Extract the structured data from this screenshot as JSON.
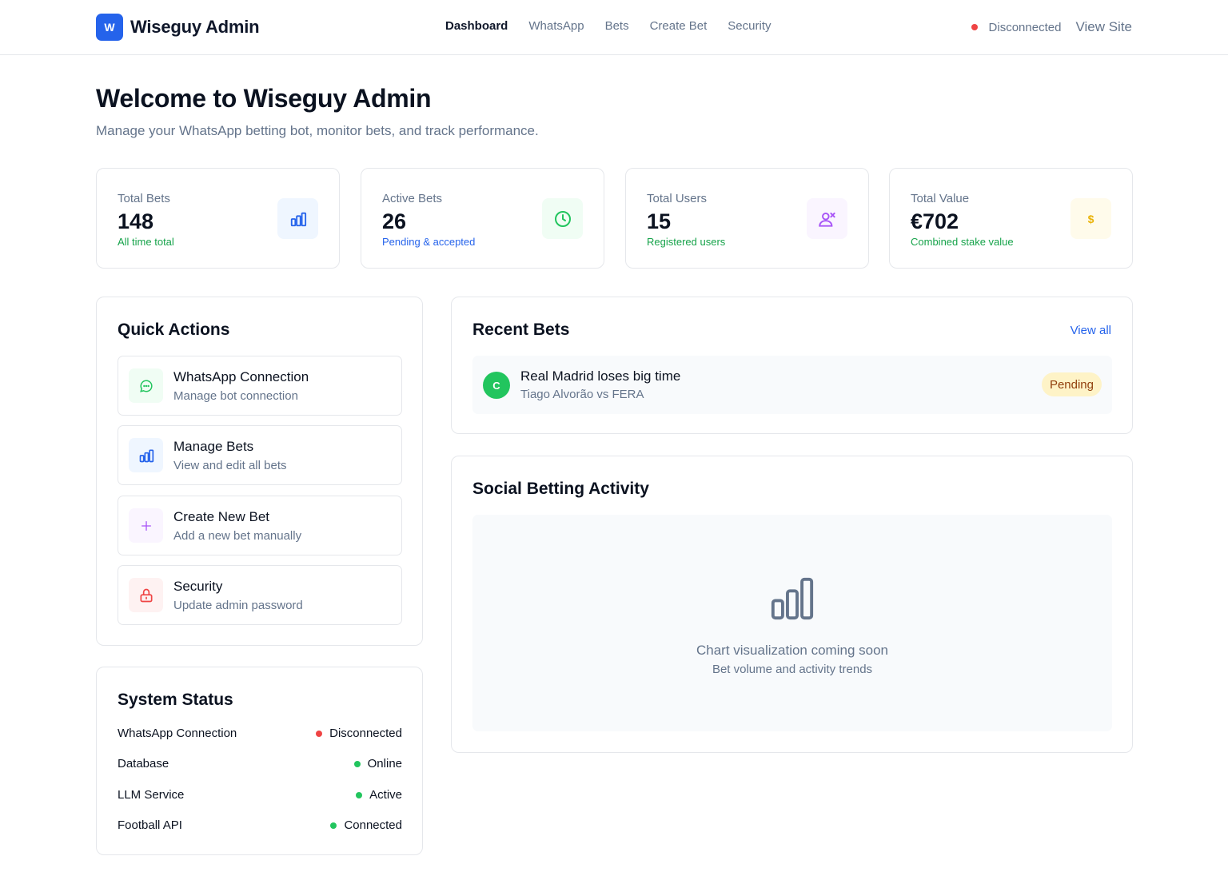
{
  "brand": {
    "mark": "W",
    "name": "Wiseguy Admin"
  },
  "nav": {
    "items": [
      "Dashboard",
      "WhatsApp",
      "Bets",
      "Create Bet",
      "Security"
    ],
    "active": "Dashboard"
  },
  "header": {
    "connection_status": "Disconnected",
    "view_site": "View Site"
  },
  "intro": {
    "title": "Welcome to Wiseguy Admin",
    "subtitle": "Manage your WhatsApp betting bot, monitor bets, and track performance."
  },
  "stats": [
    {
      "label": "Total Bets",
      "value": "148",
      "note": "All time total",
      "icon": "bar-chart-icon",
      "note_color": "#16a34a"
    },
    {
      "label": "Active Bets",
      "value": "26",
      "note": "Pending & accepted",
      "icon": "clock-icon",
      "note_color": "#2563eb"
    },
    {
      "label": "Total Users",
      "value": "15",
      "note": "Registered users",
      "icon": "users-icon",
      "note_color": "#16a34a"
    },
    {
      "label": "Total Value",
      "value": "€702",
      "note": "Combined stake value",
      "icon": "dollar-icon",
      "note_color": "#16a34a"
    }
  ],
  "quick_actions": {
    "title": "Quick Actions",
    "items": [
      {
        "title": "WhatsApp Connection",
        "subtitle": "Manage bot connection",
        "icon": "chat-icon"
      },
      {
        "title": "Manage Bets",
        "subtitle": "View and edit all bets",
        "icon": "bar-chart-icon"
      },
      {
        "title": "Create New Bet",
        "subtitle": "Add a new bet manually",
        "icon": "plus-icon"
      },
      {
        "title": "Security",
        "subtitle": "Update admin password",
        "icon": "lock-icon"
      }
    ]
  },
  "system_status": {
    "title": "System Status",
    "rows": [
      {
        "label": "WhatsApp Connection",
        "status": "Disconnected",
        "color": "#ef4444"
      },
      {
        "label": "Database",
        "status": "Online",
        "color": "#22c55e"
      },
      {
        "label": "LLM Service",
        "status": "Active",
        "color": "#22c55e"
      },
      {
        "label": "Football API",
        "status": "Connected",
        "color": "#22c55e"
      }
    ]
  },
  "recent_bets": {
    "title": "Recent Bets",
    "view_all": "View all",
    "items": [
      {
        "avatar": "C",
        "title": "Real Madrid loses big time",
        "subtitle": "Tiago Alvorão vs FERA",
        "status": "Pending"
      }
    ]
  },
  "activity": {
    "title": "Social Betting Activity",
    "message": "Chart visualization coming soon",
    "submessage": "Bet volume and activity trends"
  },
  "colors": {
    "primary": "#2563eb",
    "danger": "#ef4444",
    "success": "#22c55e",
    "pending_bg": "#fef3c7"
  }
}
